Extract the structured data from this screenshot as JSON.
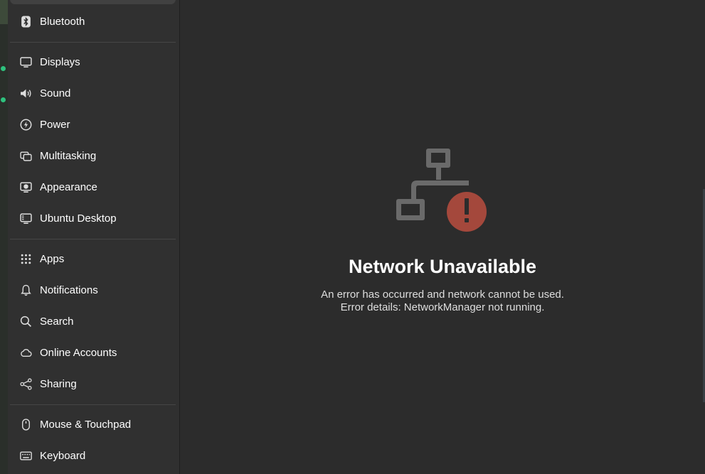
{
  "sidebar": {
    "items": [
      {
        "label": "Bluetooth",
        "icon": "bluetooth-icon"
      },
      {
        "label": "Displays",
        "icon": "display-icon"
      },
      {
        "label": "Sound",
        "icon": "speaker-icon"
      },
      {
        "label": "Power",
        "icon": "power-icon"
      },
      {
        "label": "Multitasking",
        "icon": "multitasking-icon"
      },
      {
        "label": "Appearance",
        "icon": "appearance-icon"
      },
      {
        "label": "Ubuntu Desktop",
        "icon": "ubuntu-desktop-icon"
      },
      {
        "label": "Apps",
        "icon": "apps-grid-icon"
      },
      {
        "label": "Notifications",
        "icon": "bell-icon"
      },
      {
        "label": "Search",
        "icon": "search-icon"
      },
      {
        "label": "Online Accounts",
        "icon": "cloud-icon"
      },
      {
        "label": "Sharing",
        "icon": "share-icon"
      },
      {
        "label": "Mouse & Touchpad",
        "icon": "mouse-icon"
      },
      {
        "label": "Keyboard",
        "icon": "keyboard-icon"
      }
    ]
  },
  "main": {
    "status_icon": "network-error-icon",
    "title": "Network Unavailable",
    "description_line1": "An error has occurred and network cannot be used.",
    "description_line2": "Error details: NetworkManager not running."
  },
  "colors": {
    "error_accent": "#a4483c",
    "icon_gray": "#6a6a6a",
    "background": "#2c2c2c",
    "sidebar": "#303030"
  }
}
